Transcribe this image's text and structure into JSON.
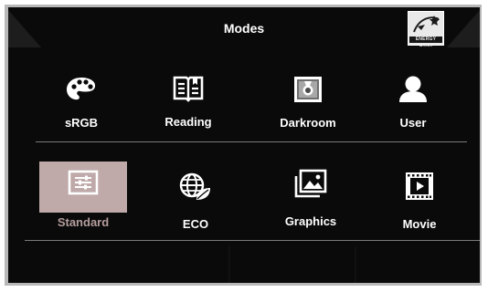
{
  "header": {
    "title": "Modes",
    "logo_text": "ENERGY STAR"
  },
  "modes_row1": [
    {
      "label": "sRGB",
      "icon": "palette-icon"
    },
    {
      "label": "Reading",
      "icon": "book-icon"
    },
    {
      "label": "Darkroom",
      "icon": "darkroom-icon"
    },
    {
      "label": "User",
      "icon": "user-icon"
    }
  ],
  "modes_row2": [
    {
      "label": "Standard",
      "icon": "sliders-icon",
      "selected": true
    },
    {
      "label": "ECO",
      "icon": "globe-leaf-icon"
    },
    {
      "label": "Graphics",
      "icon": "image-icon"
    },
    {
      "label": "Movie",
      "icon": "film-icon"
    }
  ],
  "colors": {
    "background": "#0a0a0a",
    "selected_highlight": "#bfa9a9",
    "selected_text": "#b59d9d",
    "text": "#ffffff"
  }
}
